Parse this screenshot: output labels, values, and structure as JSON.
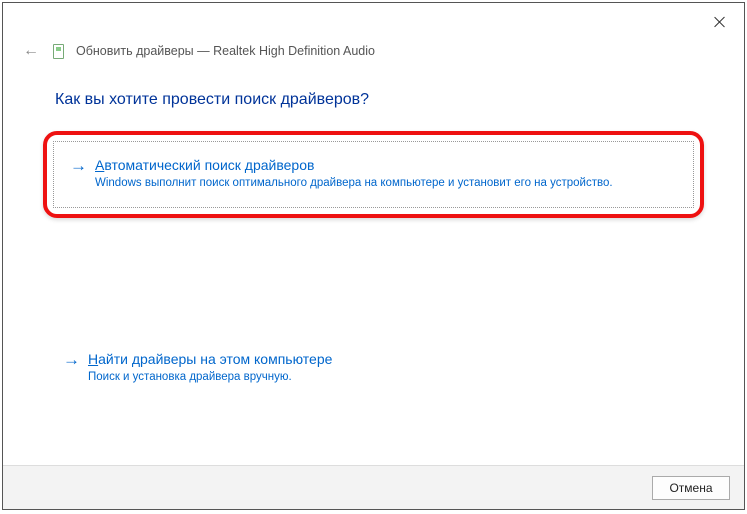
{
  "titlebar": {
    "close_aria": "Close"
  },
  "header": {
    "title": "Обновить драйверы — Realtek High Definition Audio"
  },
  "main": {
    "question": "Как вы хотите провести поиск драйверов?",
    "options": [
      {
        "hotkey": "А",
        "title_rest": "втоматический поиск драйверов",
        "desc": "Windows выполнит поиск оптимального драйвера на компьютере и установит его на устройство."
      },
      {
        "hotkey": "Н",
        "title_rest": "айти драйверы на этом компьютере",
        "desc": "Поиск и установка драйвера вручную."
      }
    ]
  },
  "footer": {
    "cancel_label": "Отмена"
  }
}
